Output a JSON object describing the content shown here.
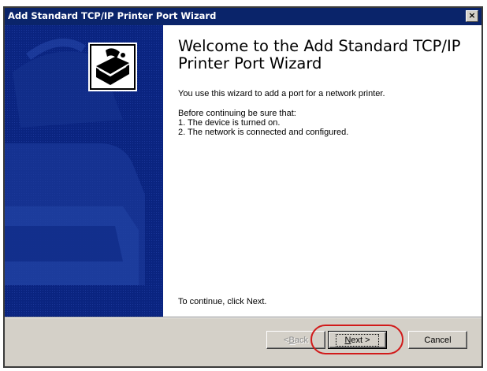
{
  "window": {
    "title": "Add Standard TCP/IP Printer Port Wizard",
    "close_glyph": "×"
  },
  "sidebar": {
    "icon": "printer-port-wizard-icon",
    "color": "#0a2480"
  },
  "content": {
    "heading": "Welcome to the Add Standard TCP/IP Printer Port Wizard",
    "intro": "You use this wizard to add a port for a network printer.",
    "before_label": "Before continuing be sure that:",
    "steps": [
      "1.  The device is turned on.",
      "2.  The network is connected and configured."
    ],
    "continue_text": "To continue, click Next."
  },
  "buttons": {
    "back": {
      "label_pre": "< ",
      "label_key": "B",
      "label_post": "ack",
      "enabled": false
    },
    "next": {
      "label_key": "N",
      "label_post": "ext >",
      "enabled": true,
      "is_default": true
    },
    "cancel": {
      "label": "Cancel",
      "enabled": true
    }
  },
  "annotation": {
    "color": "#d11a1a",
    "target": "next-button"
  }
}
